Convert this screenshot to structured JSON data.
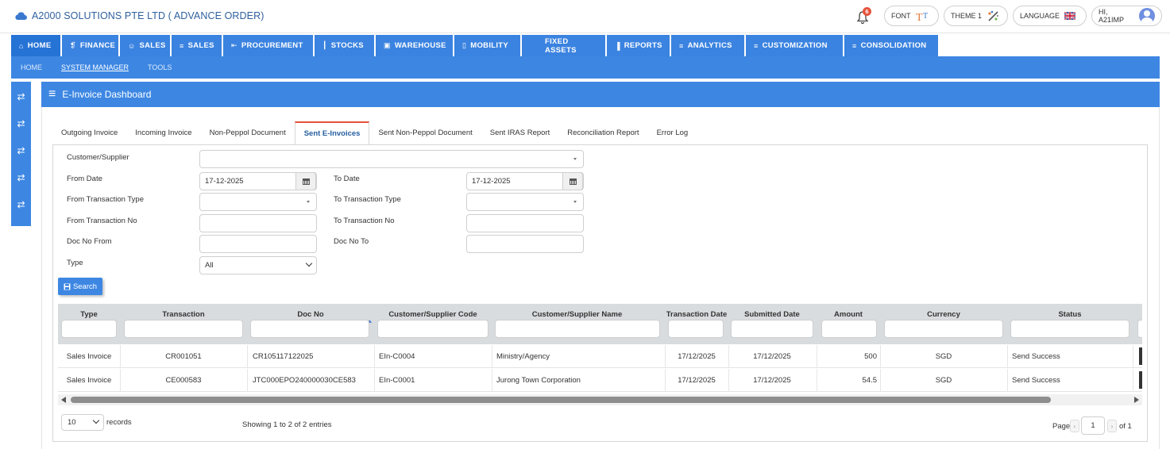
{
  "app": {
    "title": "A2000 SOLUTIONS PTE LTD ( ADVANCE ORDER)",
    "notification_count": "6",
    "font_label": "FONT",
    "theme_label": "THEME 1",
    "language_label": "LANGUAGE",
    "user_label": "HI, A21IMP"
  },
  "nav": [
    {
      "label": "HOME",
      "icon": "⌂"
    },
    {
      "label": "FINANCE",
      "icon": "❡"
    },
    {
      "label": "SALES",
      "icon": "☺"
    },
    {
      "label": "SALES",
      "icon": "≡"
    },
    {
      "label": "PROCUREMENT",
      "icon": "⇤"
    },
    {
      "label": "STOCKS",
      "icon": "┃"
    },
    {
      "label": "WAREHOUSE",
      "icon": "▣"
    },
    {
      "label": "MOBILITY",
      "icon": "▯"
    },
    {
      "label": "FIXED ASSETS",
      "icon": ""
    },
    {
      "label": "REPORTS",
      "icon": "▐"
    },
    {
      "label": "ANALYTICS",
      "icon": "≡"
    },
    {
      "label": "CUSTOMIZATION",
      "icon": "≡"
    },
    {
      "label": "CONSOLIDATION",
      "icon": "≡"
    }
  ],
  "subnav": [
    "HOME",
    "SYSTEM MANAGER",
    "TOOLS"
  ],
  "left_toolbar_icon": "⇄",
  "panel": {
    "title": "E-Invoice Dashboard",
    "menu_icon": "≡"
  },
  "tabs": [
    "Outgoing Invoice",
    "Incoming Invoice",
    "Non-Peppol Document",
    "Sent E-Invoices",
    "Sent Non-Peppol Document",
    "Sent IRAS Report",
    "Reconciliation Report",
    "Error Log"
  ],
  "form": {
    "customer_supplier": "Customer/Supplier",
    "from_date": "From Date",
    "from_date_value": "17-12-2025",
    "to_date": "To Date",
    "to_date_value": "17-12-2025",
    "from_txn_type": "From Transaction Type",
    "to_txn_type": "To Transaction Type",
    "from_txn_no": "From Transaction No",
    "to_txn_no": "To Transaction No",
    "doc_no_from": "Doc No From",
    "doc_no_to": "Doc No To",
    "type": "Type",
    "type_value": "All",
    "search_button": "Search"
  },
  "table": {
    "headers": [
      "Type",
      "Transaction",
      "Doc No",
      "Customer/Supplier Code",
      "Customer/Supplier Name",
      "Transaction Date",
      "Submitted Date",
      "Amount",
      "Currency",
      "Status"
    ],
    "rows": [
      [
        "Sales Invoice",
        "CR001051",
        "CR105117122025",
        "EIn-C0004",
        "Ministry/Agency",
        "17/12/2025",
        "17/12/2025",
        "500",
        "SGD",
        "Send Success"
      ],
      [
        "Sales Invoice",
        "CE000583",
        "JTC000EPO240000030CE583",
        "EIn-C0001",
        "Jurong Town Corporation",
        "17/12/2025",
        "17/12/2025",
        "54.5",
        "SGD",
        "Send Success"
      ]
    ]
  },
  "footer": {
    "page_size": "10",
    "records_label": "records",
    "showing": "Showing 1 to 2 of 2 entries",
    "page_label": "Page",
    "page_value": "1",
    "of_label": "of 1"
  }
}
